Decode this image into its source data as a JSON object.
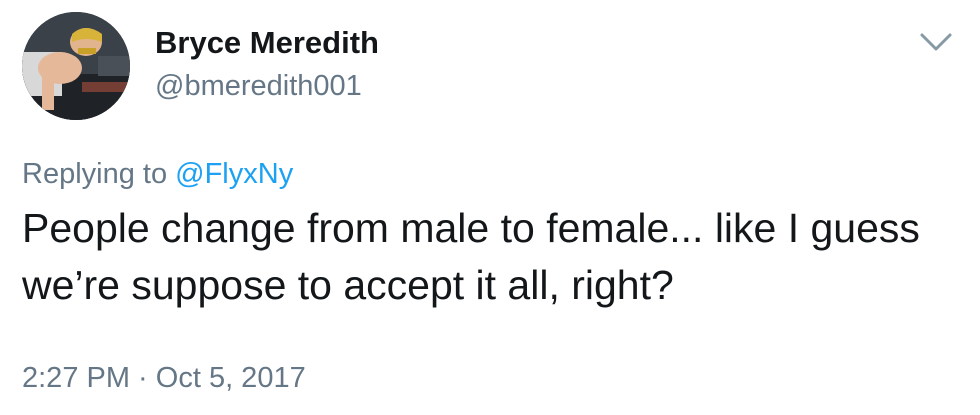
{
  "author": {
    "display_name": "Bryce Meredith",
    "handle": "@bmeredith001"
  },
  "reply": {
    "prefix": "Replying to ",
    "mention": "@FlyxNy"
  },
  "tweet": {
    "text": "People change from male to female... like I guess we’re suppose to accept it all, right?"
  },
  "meta": {
    "timestamp": "2:27 PM · Oct 5, 2017"
  },
  "icons": {
    "menu": "chevron-down-icon",
    "avatar": "profile-photo"
  },
  "colors": {
    "text": "#14171a",
    "secondary": "#657786",
    "link": "#1da1f2"
  }
}
